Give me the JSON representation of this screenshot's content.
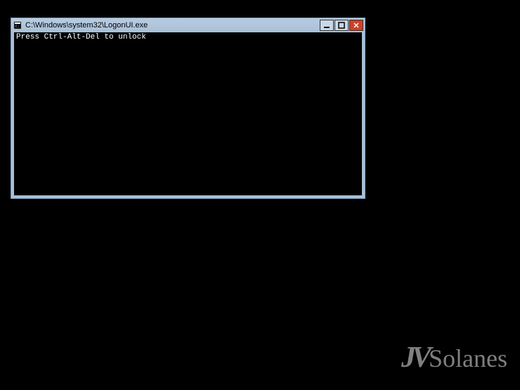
{
  "window": {
    "title": "C:\\Windows\\system32\\LogonUI.exe",
    "console_text": "Press Ctrl-Alt-Del to unlock"
  },
  "watermark": {
    "prefix": "JV",
    "suffix": "Solanes"
  }
}
